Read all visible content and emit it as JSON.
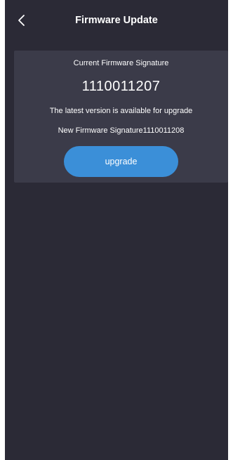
{
  "header": {
    "title": "Firmware Update",
    "back_icon": "chevron-left-icon"
  },
  "card": {
    "current_label": "Current Firmware Signature",
    "current_value": "1110011207",
    "latest_message": "The latest version is available for upgrade",
    "new_signature_text": "New Firmware Signature1110011208",
    "upgrade_label": "upgrade"
  },
  "colors": {
    "background": "#2b2a36",
    "card": "#3b3b49",
    "accent": "#3b8fd8",
    "text": "#ffffff"
  }
}
